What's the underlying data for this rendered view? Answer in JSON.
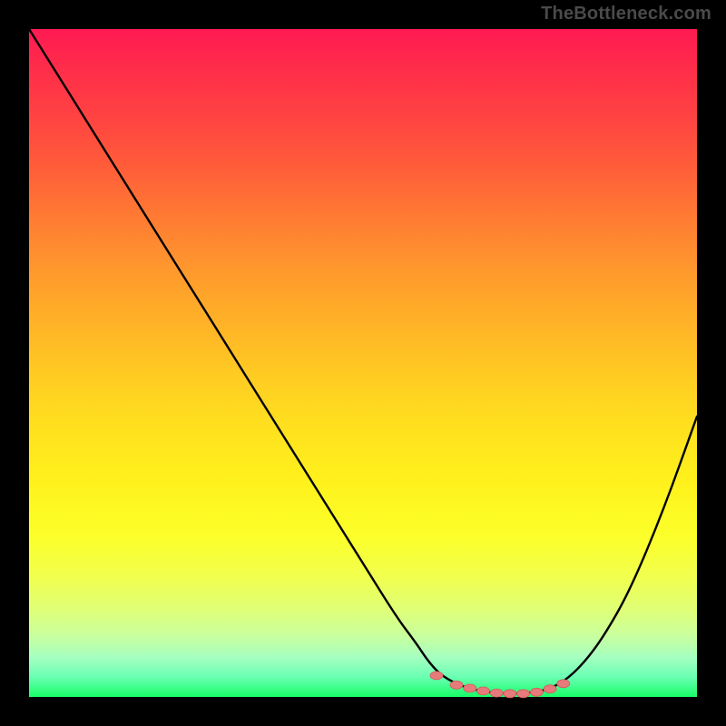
{
  "watermark": "TheBottleneck.com",
  "colors": {
    "curve_stroke": "#000000",
    "marker_fill": "#e77a7a",
    "marker_stroke": "#d05c5c",
    "background_black": "#000000"
  },
  "chart_data": {
    "type": "line",
    "title": "",
    "xlabel": "",
    "ylabel": "",
    "xlim": [
      0,
      100
    ],
    "ylim": [
      0,
      100
    ],
    "x": [
      0,
      5,
      10,
      15,
      20,
      25,
      30,
      35,
      40,
      45,
      50,
      55,
      58,
      60,
      62,
      65,
      68,
      71,
      74,
      77,
      80,
      83,
      86,
      90,
      95,
      100
    ],
    "values": [
      100,
      92,
      84,
      76,
      68,
      60,
      52,
      44,
      36,
      28,
      20,
      12,
      8,
      5,
      3,
      1.5,
      0.8,
      0.5,
      0.5,
      0.9,
      2.2,
      5,
      9,
      16,
      28,
      42
    ],
    "markers": {
      "x": [
        61,
        64,
        66,
        68,
        70,
        72,
        74,
        76,
        78,
        80
      ],
      "y": [
        3.2,
        1.8,
        1.3,
        0.9,
        0.6,
        0.5,
        0.5,
        0.7,
        1.2,
        2.0
      ]
    },
    "gradient_stops": [
      {
        "pos": 0,
        "color": "#ff1a52"
      },
      {
        "pos": 50,
        "color": "#ffcc22"
      },
      {
        "pos": 80,
        "color": "#f7ff3a"
      },
      {
        "pos": 100,
        "color": "#17ff66"
      }
    ]
  }
}
